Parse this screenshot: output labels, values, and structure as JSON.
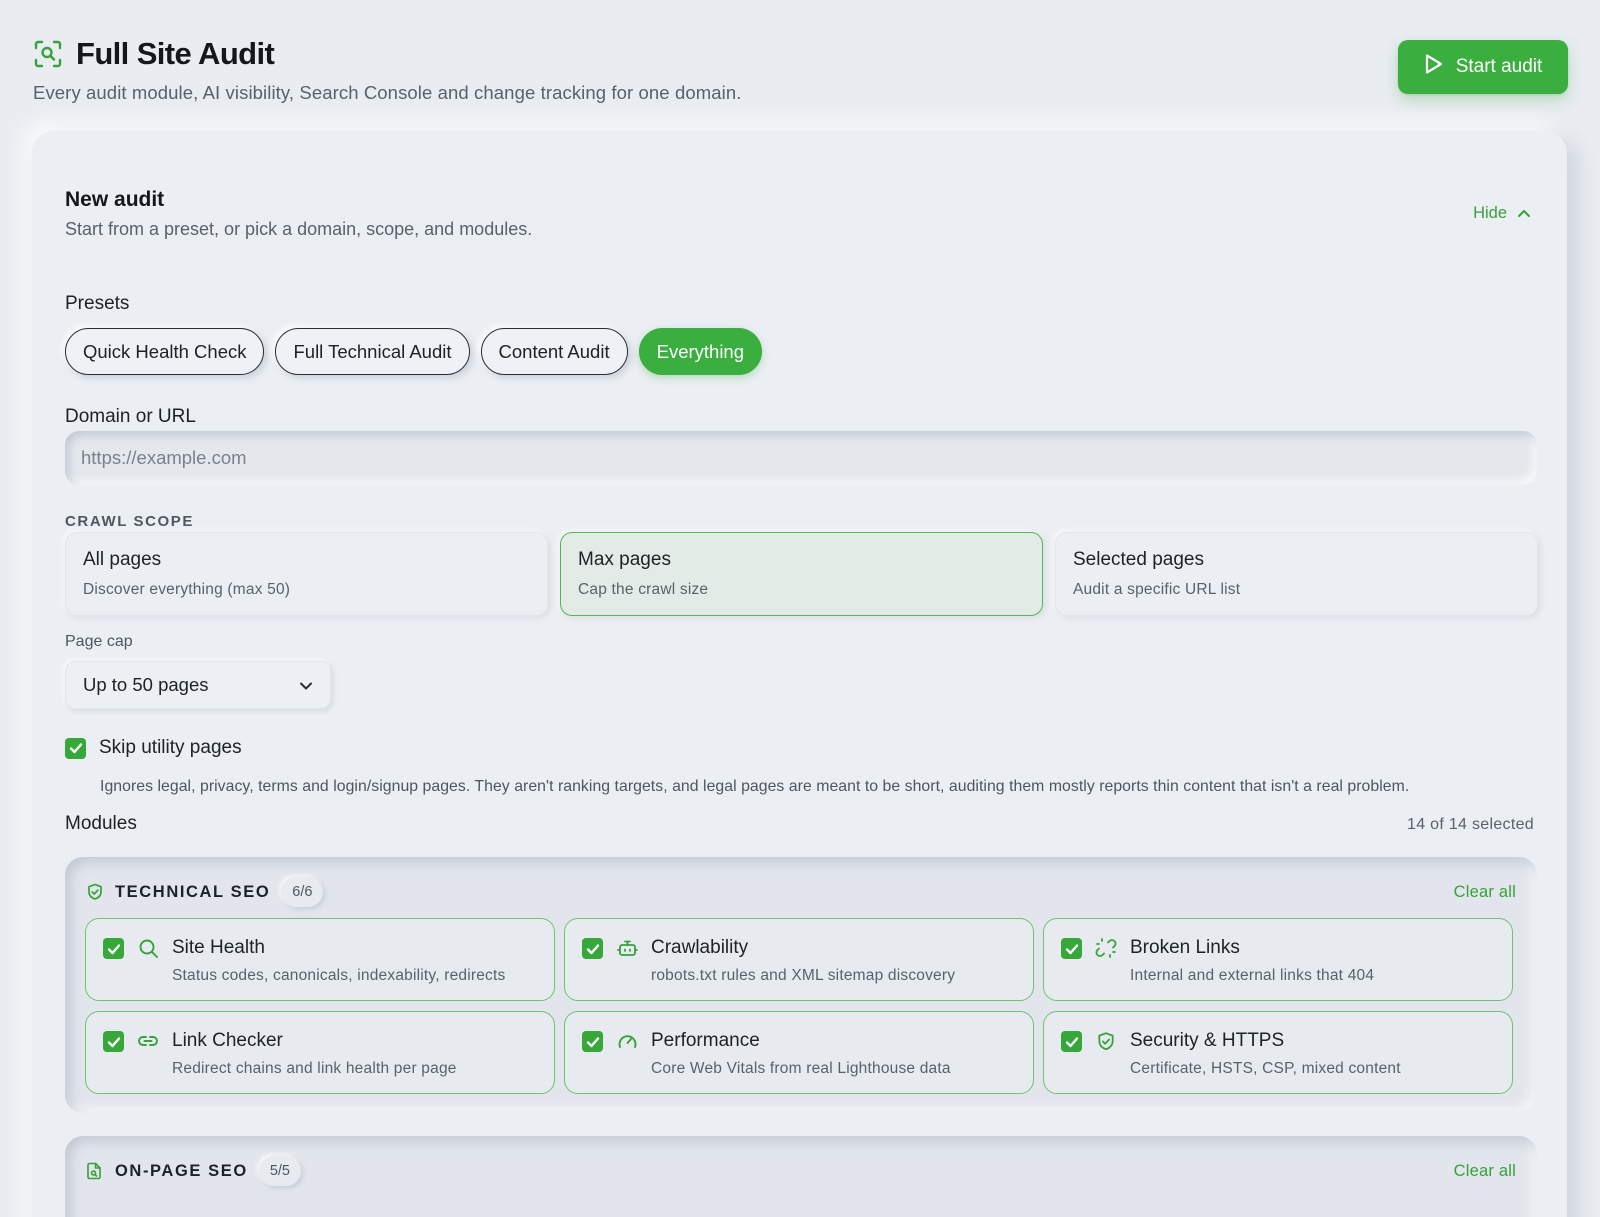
{
  "header": {
    "title": "Full Site Audit",
    "subtitle": "Every audit module, AI visibility, Search Console and change tracking for one domain.",
    "start_label": "Start audit"
  },
  "new_audit": {
    "title": "New audit",
    "subtitle": "Start from a preset, or pick a domain, scope, and modules.",
    "hide_label": "Hide"
  },
  "presets": {
    "label": "Presets",
    "items": [
      {
        "label": "Quick Health Check",
        "active": false
      },
      {
        "label": "Full Technical Audit",
        "active": false
      },
      {
        "label": "Content Audit",
        "active": false
      },
      {
        "label": "Everything",
        "active": true
      }
    ]
  },
  "domain": {
    "label": "Domain or URL",
    "placeholder": "https://example.com",
    "value": ""
  },
  "crawl_scope": {
    "label": "CRAWL SCOPE",
    "options": [
      {
        "title": "All pages",
        "desc": "Discover everything (max 50)",
        "selected": false
      },
      {
        "title": "Max pages",
        "desc": "Cap the crawl size",
        "selected": true
      },
      {
        "title": "Selected pages",
        "desc": "Audit a specific URL list",
        "selected": false
      }
    ]
  },
  "page_cap": {
    "label": "Page cap",
    "value": "Up to 50 pages"
  },
  "skip_utility": {
    "checked": true,
    "label": "Skip utility pages",
    "desc": "Ignores legal, privacy, terms and login/signup pages. They aren't ranking targets, and legal pages are meant to be short, auditing them mostly reports thin content that isn't a real problem."
  },
  "modules": {
    "label": "Modules",
    "count_text": "14 of 14 selected",
    "groups": [
      {
        "title": "TECHNICAL SEO",
        "badge": "6/6",
        "clear_label": "Clear all",
        "icon": "shield-check-icon",
        "items": [
          {
            "name": "Site Health",
            "desc": "Status codes, canonicals, indexability, redirects",
            "icon": "search-icon",
            "checked": true
          },
          {
            "name": "Crawlability",
            "desc": "robots.txt rules and XML sitemap discovery",
            "icon": "robot-icon",
            "checked": true
          },
          {
            "name": "Broken Links",
            "desc": "Internal and external links that 404",
            "icon": "broken-link-icon",
            "checked": true
          },
          {
            "name": "Link Checker",
            "desc": "Redirect chains and link health per page",
            "icon": "link-icon",
            "checked": true
          },
          {
            "name": "Performance",
            "desc": "Core Web Vitals from real Lighthouse data",
            "icon": "gauge-icon",
            "checked": true
          },
          {
            "name": "Security & HTTPS",
            "desc": "Certificate, HSTS, CSP, mixed content",
            "icon": "shield-check-icon",
            "checked": true
          }
        ]
      },
      {
        "title": "ON-PAGE SEO",
        "badge": "5/5",
        "clear_label": "Clear all",
        "icon": "document-icon",
        "items": []
      }
    ]
  },
  "colors": {
    "accent": "#3aae3e",
    "background": "#e9ecf1",
    "text": "#1d2128"
  }
}
